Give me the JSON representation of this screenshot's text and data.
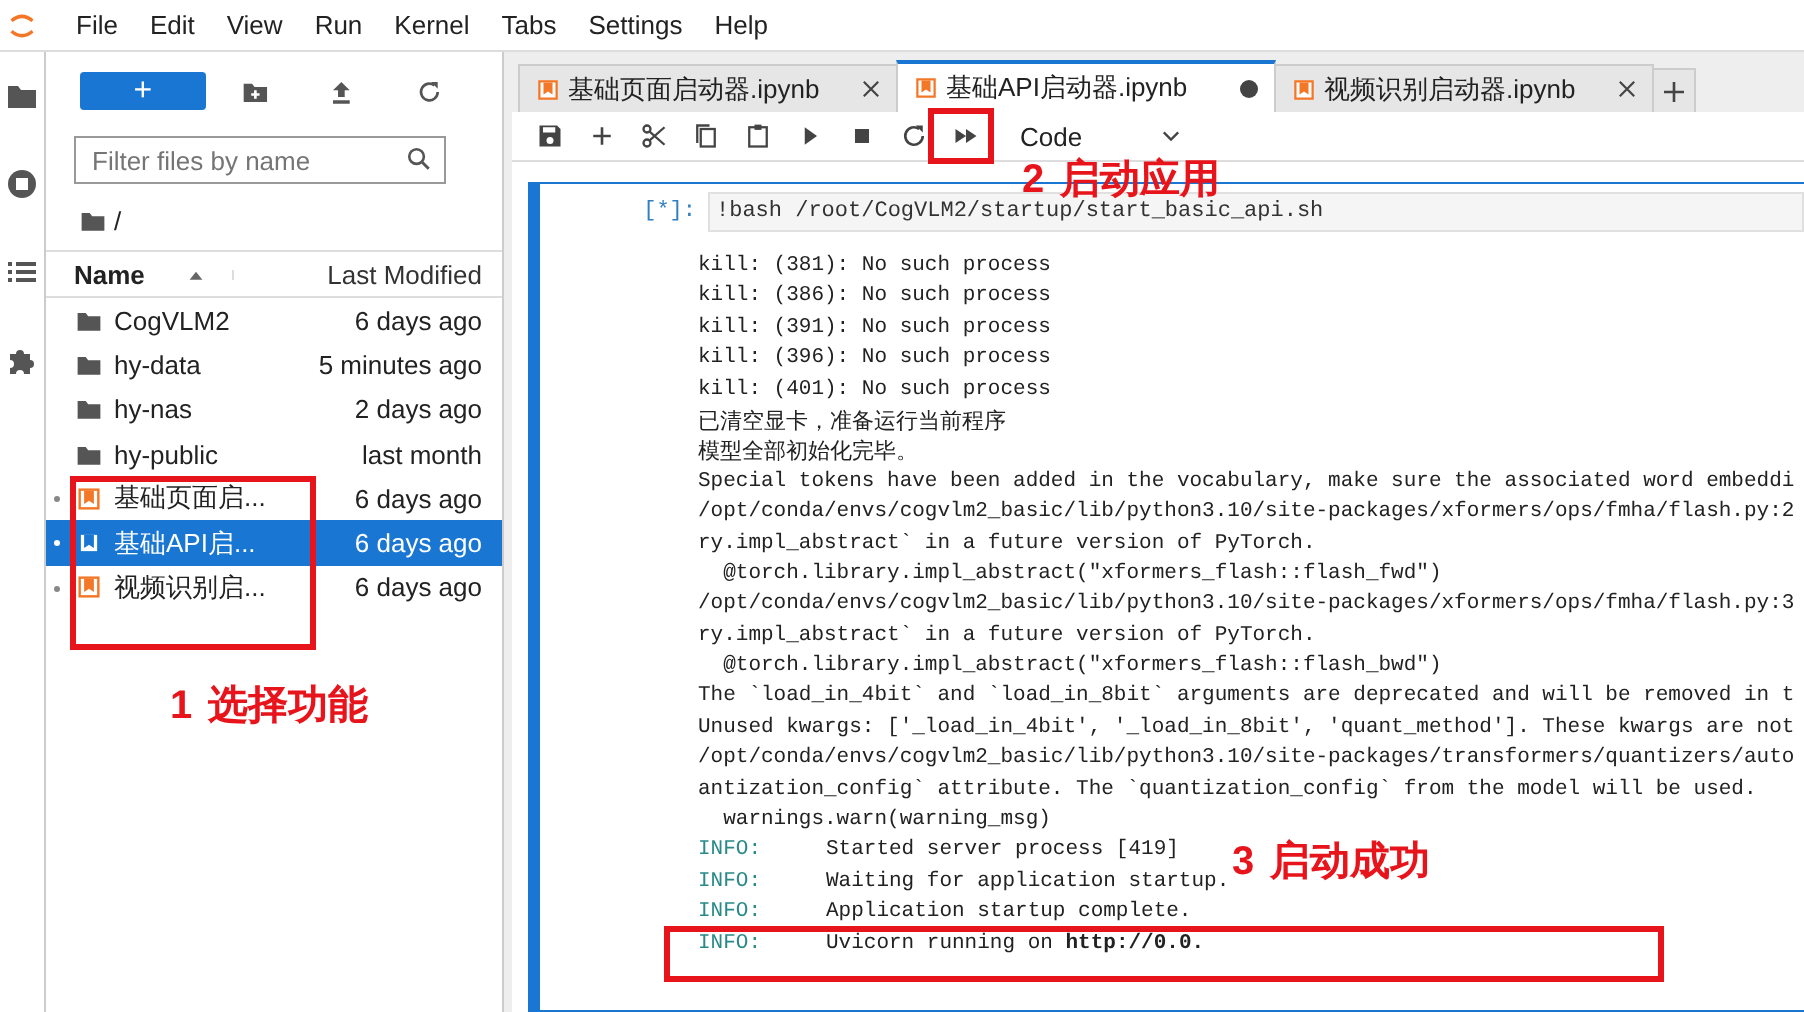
{
  "menu": [
    "File",
    "Edit",
    "View",
    "Run",
    "Kernel",
    "Tabs",
    "Settings",
    "Help"
  ],
  "file_browser": {
    "new_button": "+",
    "filter": {
      "placeholder": "Filter files by name"
    },
    "path": "/",
    "columns": [
      "Name",
      "Last Modified"
    ],
    "rows": [
      {
        "kind": "folder",
        "name": "CogVLM2",
        "modified": "6 days ago",
        "selected": false,
        "running": false
      },
      {
        "kind": "folder",
        "name": "hy-data",
        "modified": "5 minutes ago",
        "selected": false,
        "running": false
      },
      {
        "kind": "folder",
        "name": "hy-nas",
        "modified": "2 days ago",
        "selected": false,
        "running": false
      },
      {
        "kind": "folder",
        "name": "hy-public",
        "modified": "last month",
        "selected": false,
        "running": false
      },
      {
        "kind": "notebook",
        "name": "基础页面启...",
        "modified": "6 days ago",
        "selected": false,
        "running": true
      },
      {
        "kind": "notebook",
        "name": "基础API启...",
        "modified": "6 days ago",
        "selected": true,
        "running": true
      },
      {
        "kind": "notebook",
        "name": "视频识别启...",
        "modified": "6 days ago",
        "selected": false,
        "running": true
      }
    ]
  },
  "tabs": [
    {
      "label": "基础页面启动器.ipynb",
      "selected": false,
      "modified": false
    },
    {
      "label": "基础API启动器.ipynb",
      "selected": true,
      "modified": true
    },
    {
      "label": "视频识别启动器.ipynb",
      "selected": false,
      "modified": false
    }
  ],
  "cell_type": "Code",
  "cell": {
    "prompt": "[*]:",
    "source": "!bash /root/CogVLM2/startup/start_basic_api.sh",
    "output": [
      {
        "kind": "log",
        "text": "kill: (381): No such process"
      },
      {
        "kind": "log",
        "text": "kill: (386): No such process"
      },
      {
        "kind": "log",
        "text": "kill: (391): No such process"
      },
      {
        "kind": "log",
        "text": "kill: (396): No such process"
      },
      {
        "kind": "log",
        "text": "kill: (401): No such process"
      },
      {
        "kind": "cjk",
        "text": "已清空显卡，准备运行当前程序"
      },
      {
        "kind": "cjk",
        "text": "模型全部初始化完毕。"
      },
      {
        "kind": "log",
        "text": "Special tokens have been added in the vocabulary, make sure the associated word embeddi"
      },
      {
        "kind": "log",
        "text": "/opt/conda/envs/cogvlm2_basic/lib/python3.10/site-packages/xformers/ops/fmha/flash.py:2"
      },
      {
        "kind": "log",
        "text": "ry.impl_abstract` in a future version of PyTorch."
      },
      {
        "kind": "log",
        "text": "  @torch.library.impl_abstract(\"xformers_flash::flash_fwd\")"
      },
      {
        "kind": "log",
        "text": "/opt/conda/envs/cogvlm2_basic/lib/python3.10/site-packages/xformers/ops/fmha/flash.py:3"
      },
      {
        "kind": "log",
        "text": "ry.impl_abstract` in a future version of PyTorch."
      },
      {
        "kind": "log",
        "text": "  @torch.library.impl_abstract(\"xformers_flash::flash_bwd\")"
      },
      {
        "kind": "log",
        "text": "The `load_in_4bit` and `load_in_8bit` arguments are deprecated and will be removed in t"
      },
      {
        "kind": "log",
        "text": "Unused kwargs: ['_load_in_4bit', '_load_in_8bit', 'quant_method']. These kwargs are not"
      },
      {
        "kind": "log",
        "text": "/opt/conda/envs/cogvlm2_basic/lib/python3.10/site-packages/transformers/quantizers/auto"
      },
      {
        "kind": "log",
        "text": "antization_config` attribute. The `quantization_config` from the model will be used."
      },
      {
        "kind": "log",
        "text": "  warnings.warn(warning_msg)"
      },
      {
        "kind": "info",
        "prefix": "INFO:",
        "text": "Started server process [419]"
      },
      {
        "kind": "info",
        "prefix": "INFO:",
        "text": "Waiting for application startup."
      },
      {
        "kind": "info",
        "prefix": "INFO:",
        "text": "Application startup complete."
      },
      {
        "kind": "info",
        "prefix": "INFO:",
        "text": "Uvicorn running on **http://0.0.**"
      }
    ]
  },
  "annotations": [
    {
      "number": "1",
      "label": "选择功能"
    },
    {
      "number": "2",
      "label": "启动应用"
    },
    {
      "number": "3",
      "label": "启动成功"
    }
  ]
}
